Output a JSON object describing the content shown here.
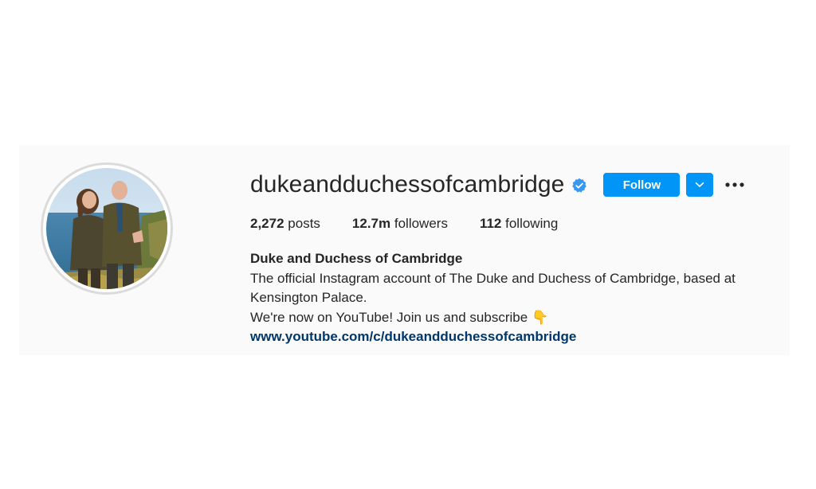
{
  "profile": {
    "username": "dukeandduchessofcambridge",
    "verified": true,
    "icons": {
      "verified": "verified-badge-icon",
      "dropdown": "chevron-down-icon",
      "more": "more-options-icon",
      "bio_emoji": "pointing-down-hand-icon"
    },
    "buttons": {
      "follow": "Follow"
    },
    "stats": {
      "posts_count": "2,272",
      "posts_label": "posts",
      "followers_count": "12.7m",
      "followers_label": "followers",
      "following_count": "112",
      "following_label": "following"
    },
    "bio": {
      "name": "Duke and Duchess of Cambridge",
      "description": "The official Instagram account of The Duke and Duchess of Cambridge, based at Kensington Palace.",
      "cta": "We're now on YouTube! Join us and subscribe",
      "emoji": "👇",
      "link": "www.youtube.com/c/dukeandduchessofcambridge"
    },
    "colors": {
      "accent": "#0095f6",
      "verified": "#3897f0",
      "link": "#00376b",
      "card_bg": "#fafafa",
      "text": "#262626"
    }
  }
}
